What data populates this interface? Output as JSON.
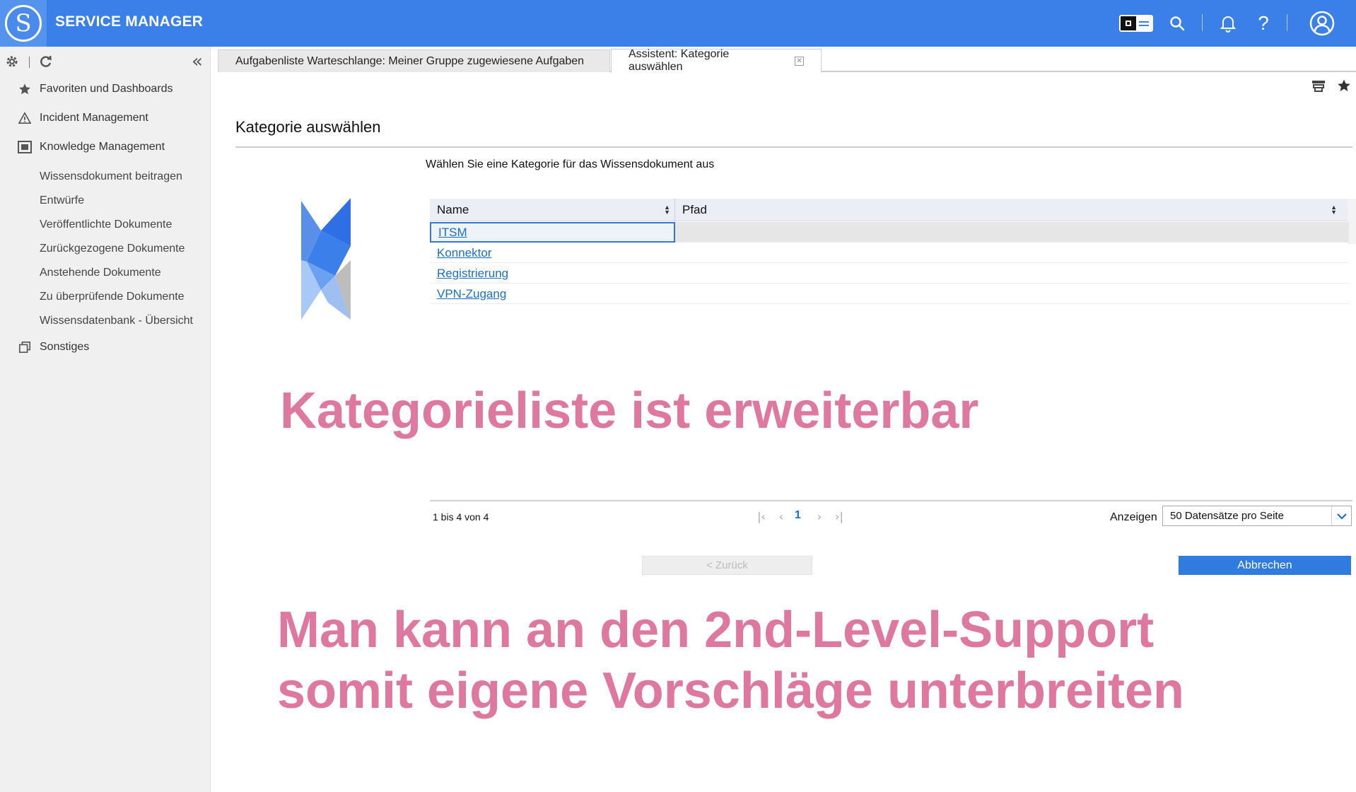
{
  "header": {
    "app_title": "SERVICE MANAGER",
    "logo_letter": "S",
    "icons": [
      "layout-toggle-icon",
      "search-icon",
      "bell-icon",
      "help-icon",
      "user-icon"
    ],
    "help_glyph": "?"
  },
  "sidebar": {
    "tools": [
      "gear-icon",
      "refresh-icon",
      "collapse-icon"
    ],
    "collapse_glyph": "«",
    "items": [
      {
        "label": "Favoriten und Dashboards",
        "icon": "star-icon"
      },
      {
        "label": "Incident Management",
        "icon": "warning-icon"
      },
      {
        "label": "Knowledge Management",
        "icon": "book-icon"
      },
      {
        "label": "Wissensdokument beitragen"
      },
      {
        "label": "Entwürfe"
      },
      {
        "label": "Veröffentlichte Dokumente"
      },
      {
        "label": "Zurückgezogene Dokumente"
      },
      {
        "label": "Anstehende Dokumente"
      },
      {
        "label": "Zu überprüfende Dokumente"
      },
      {
        "label": "Wissensdatenbank - Übersicht"
      },
      {
        "label": "Sonstiges",
        "icon": "stack-icon"
      }
    ]
  },
  "tabs": [
    {
      "label": "Aufgabenliste Warteschlange: Meiner Gruppe zugewiesene Aufgaben",
      "active": false
    },
    {
      "label": "Assistent: Kategorie auswählen",
      "active": true
    }
  ],
  "main": {
    "title": "Kategorie auswählen",
    "instruction": "Wählen Sie eine Kategorie für das Wissensdokument aus",
    "grid": {
      "columns": [
        "Name",
        "Pfad"
      ],
      "rows": [
        {
          "name": "ITSM",
          "path": "",
          "selected": true
        },
        {
          "name": "Konnektor",
          "path": ""
        },
        {
          "name": "Registrierung",
          "path": ""
        },
        {
          "name": "VPN-Zugang",
          "path": ""
        }
      ]
    },
    "pager": {
      "info": "1 bis 4 von 4",
      "page": "1",
      "first_glyph": "|‹",
      "prev_glyph": "‹",
      "next_glyph": "›",
      "last_glyph": "›|",
      "show_label": "Anzeigen",
      "page_size": "50 Datensätze pro Seite"
    },
    "buttons": {
      "back": "< Zurück",
      "cancel": "Abbrechen"
    }
  },
  "annotations": {
    "line1": "Kategorieliste ist erweiterbar",
    "line2a": "Man kann an den 2nd-Level-Support",
    "line2b": "somit eigene Vorschläge unterbreiten"
  },
  "colors": {
    "header_bg": "#3a80e8",
    "accent": "#2f7be0",
    "link": "#1a6fc9",
    "annotation": "#de789e"
  }
}
